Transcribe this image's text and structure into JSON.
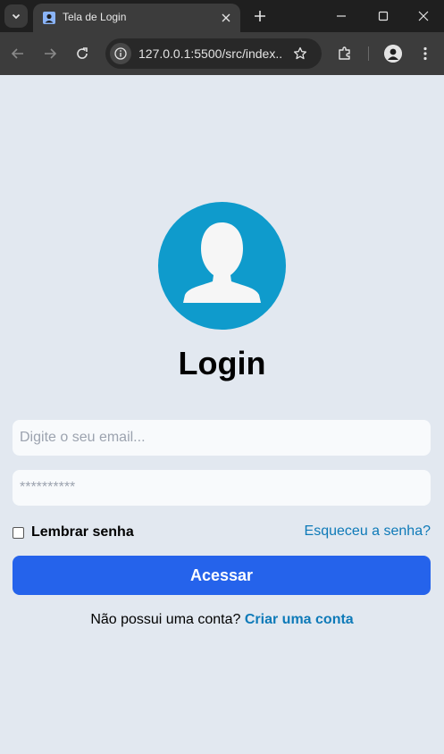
{
  "browser": {
    "tab_title": "Tela de Login",
    "url": "127.0.0.1:5500/src/index...",
    "new_tab_label": "+"
  },
  "page": {
    "title": "Login",
    "email_placeholder": "Digite o seu email...",
    "password_placeholder": "**********",
    "remember_label": "Lembrar senha",
    "forgot_link": "Esqueceu a senha?",
    "submit_label": "Acessar",
    "signup_prompt": "Não possui uma conta?",
    "signup_link": "Criar uma conta"
  },
  "colors": {
    "page_bg": "#e2e8f0",
    "avatar_circle": "#0f9bcc",
    "primary_button": "#2563eb",
    "link": "#0e7ab8"
  },
  "icons": [
    "tab-search-icon",
    "favicon-icon",
    "close-icon",
    "plus-icon",
    "minimize-icon",
    "maximize-icon",
    "window-close-icon",
    "back-icon",
    "forward-icon",
    "reload-icon",
    "info-icon",
    "star-icon",
    "extensions-icon",
    "profile-icon",
    "menu-dots-icon",
    "user-avatar-icon"
  ]
}
